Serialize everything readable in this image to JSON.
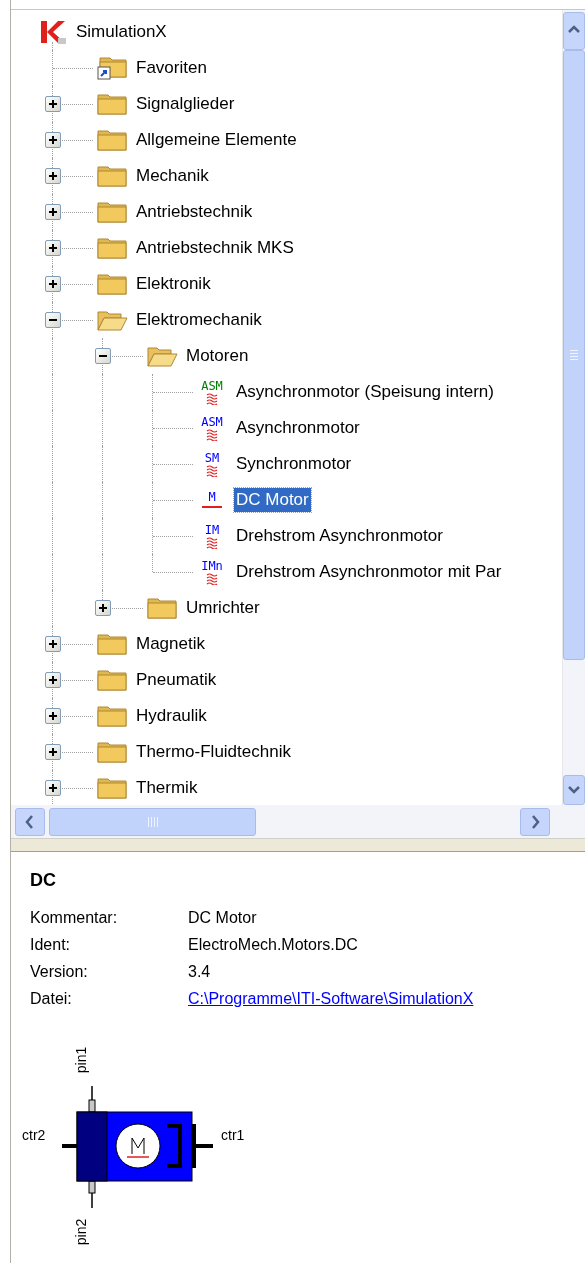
{
  "tree": {
    "label": "SimulationX",
    "kind": "root",
    "children": [
      {
        "label": "Favoriten",
        "kind": "favorites"
      },
      {
        "label": "Signalglieder",
        "kind": "folder",
        "expanded": false
      },
      {
        "label": "Allgemeine Elemente",
        "kind": "folder",
        "expanded": false
      },
      {
        "label": "Mechanik",
        "kind": "folder",
        "expanded": false
      },
      {
        "label": "Antriebstechnik",
        "kind": "folder",
        "expanded": false
      },
      {
        "label": "Antriebstechnik MKS",
        "kind": "folder",
        "expanded": false
      },
      {
        "label": "Elektronik",
        "kind": "folder",
        "expanded": false
      },
      {
        "label": "Elektromechanik",
        "kind": "folder",
        "expanded": true,
        "children": [
          {
            "label": "Motoren",
            "kind": "folder",
            "expanded": true,
            "children": [
              {
                "label": "Asynchronmotor (Speisung intern)",
                "kind": "ac-component",
                "badge": "ASM",
                "color": "#008000",
                "selected": false
              },
              {
                "label": "Asynchronmotor",
                "kind": "ac-component",
                "badge": "ASM",
                "color": "#0000ff",
                "selected": false
              },
              {
                "label": "Synchronmotor",
                "kind": "ac-component",
                "badge": "SM",
                "color": "#0000ff",
                "selected": false
              },
              {
                "label": "DC Motor",
                "kind": "dc-component",
                "badge": "M",
                "color": "#0000ff",
                "selected": true
              },
              {
                "label": "Drehstrom Asynchronmotor",
                "kind": "ac-component",
                "badge": "IM",
                "color": "#0000ff",
                "selected": false
              },
              {
                "label": "Drehstrom Asynchronmotor mit Par",
                "kind": "ac-component",
                "badge": "IMn",
                "color": "#0000ff",
                "selected": false
              }
            ]
          },
          {
            "label": "Umrichter",
            "kind": "folder",
            "expanded": false
          }
        ]
      },
      {
        "label": "Magnetik",
        "kind": "folder",
        "expanded": false
      },
      {
        "label": "Pneumatik",
        "kind": "folder",
        "expanded": false
      },
      {
        "label": "Hydraulik",
        "kind": "folder",
        "expanded": false
      },
      {
        "label": "Thermo-Fluidtechnik",
        "kind": "folder",
        "expanded": false
      },
      {
        "label": "Thermik",
        "kind": "folder",
        "expanded": false
      }
    ]
  },
  "details": {
    "title": "DC",
    "fields": [
      {
        "label": "Kommentar:",
        "value": "DC Motor",
        "kind": "text"
      },
      {
        "label": "Ident:",
        "value": "ElectroMech.Motors.DC",
        "kind": "text"
      },
      {
        "label": "Version:",
        "value": "3.4",
        "kind": "text"
      },
      {
        "label": "Datei:",
        "value": "C:\\Programme\\ITI-Software\\SimulationX",
        "kind": "link"
      }
    ]
  },
  "symbol": {
    "ports": [
      "pin1",
      "ctr2",
      "ctr1",
      "pin2"
    ]
  }
}
